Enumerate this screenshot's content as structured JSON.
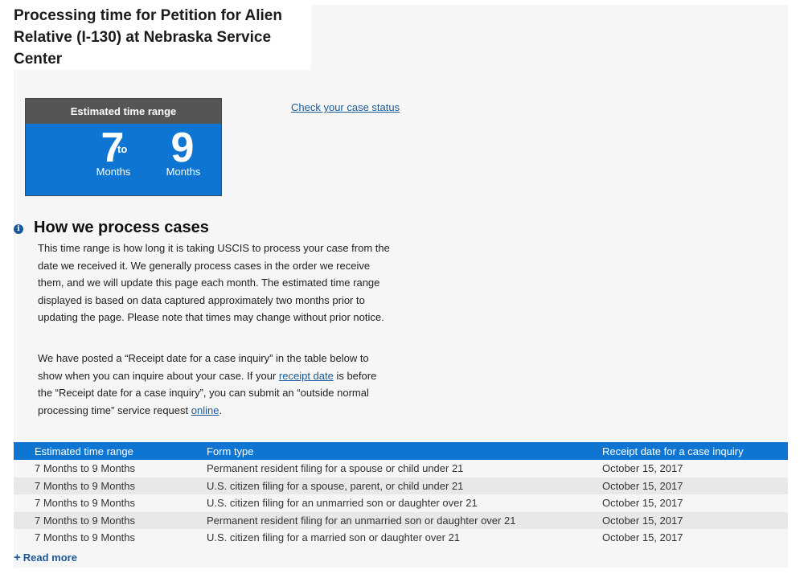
{
  "page": {
    "title": "Processing time for Petition for Alien Relative (I-130) at Nebraska Service Center"
  },
  "estimate": {
    "header": "Estimated time range",
    "low": "7",
    "high": "9",
    "to": "to",
    "low_unit": "Months",
    "high_unit": "Months"
  },
  "links": {
    "check_status": "Check your case status"
  },
  "section": {
    "heading": "How we process cases",
    "paragraph1": "This time range is how long it is taking USCIS to process your case from the date we received it. We generally process cases in the order we receive them, and we will update this page each month. The estimated time range displayed is based on data captured approximately two months prior to updating the page. Please note that times may change without prior notice.",
    "paragraph2_part1": "We have posted a “Receipt date for a case inquiry” in the table below to show when you can inquire about your case. If your ",
    "paragraph2_link1": "receipt date",
    "paragraph2_part2": " is before the “Receipt date for a case inquiry”, you can submit an “outside normal processing time” service request ",
    "paragraph2_link2": "online",
    "paragraph2_part3": "."
  },
  "table": {
    "headers": [
      "Estimated time range",
      "Form type",
      "Receipt date for a case inquiry"
    ],
    "rows": [
      [
        "7 Months to 9 Months",
        "Permanent resident filing for a spouse or child under 21",
        "October 15, 2017"
      ],
      [
        "7 Months to 9 Months",
        "U.S. citizen filing for a spouse, parent, or child under 21",
        "October 15, 2017"
      ],
      [
        "7 Months to 9 Months",
        "U.S. citizen filing for an unmarried son or daughter over 21",
        "October 15, 2017"
      ],
      [
        "7 Months to 9 Months",
        "Permanent resident filing for an unmarried son or daughter over 21",
        "October 15, 2017"
      ],
      [
        "7 Months to 9 Months",
        "U.S. citizen filing for a married son or daughter over 21",
        "October 15, 2017"
      ]
    ]
  },
  "read_more": {
    "label": "Read more"
  }
}
